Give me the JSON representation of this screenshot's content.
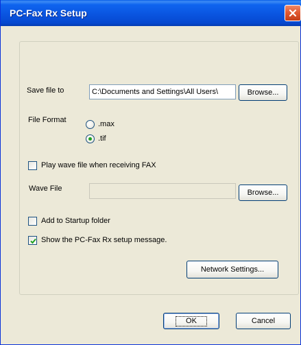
{
  "window": {
    "title": "PC-Fax Rx Setup",
    "close_glyph": "✕"
  },
  "save": {
    "label": "Save file to",
    "path": "C:\\Documents and Settings\\All Users\\",
    "browse_label": "Browse..."
  },
  "format": {
    "label": "File Format",
    "options": [
      {
        "label": ".max",
        "selected": false
      },
      {
        "label": ".tif",
        "selected": true
      }
    ]
  },
  "wave": {
    "play_label": "Play wave file when receiving FAX",
    "play_checked": false,
    "file_label": "Wave File",
    "file_value": "",
    "browse_label": "Browse..."
  },
  "startup": {
    "label": "Add to Startup folder",
    "checked": false
  },
  "show_message": {
    "label": "Show the PC-Fax Rx setup message.",
    "checked": true
  },
  "network_button": "Network Settings...",
  "footer": {
    "ok_label": "OK",
    "cancel_label": "Cancel"
  },
  "colors": {
    "titlebar": "#0a55e0",
    "close_button": "#e25a33",
    "face": "#ece9d8",
    "radio_dot": "#21a121",
    "check_mark": "#21a121"
  }
}
